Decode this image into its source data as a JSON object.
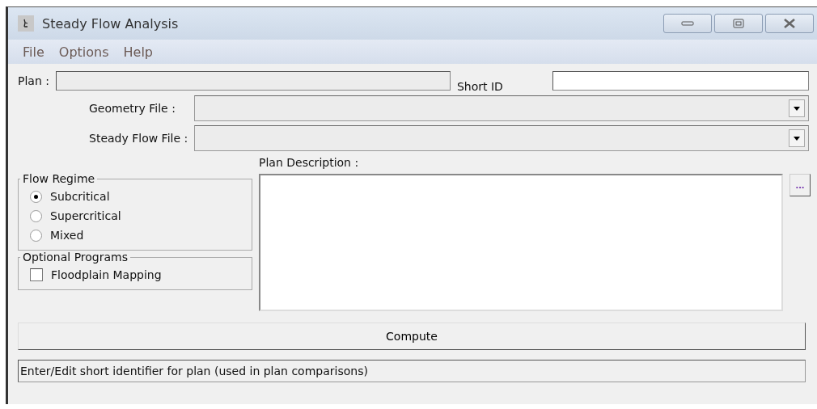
{
  "window": {
    "title": "Steady Flow Analysis"
  },
  "menu": [
    "File",
    "Options",
    "Help"
  ],
  "plan": {
    "label": "Plan :",
    "disabled": true
  },
  "short_id": {
    "label": "Short ID"
  },
  "geometry_file": {
    "label": "Geometry File :"
  },
  "steady_flow_file": {
    "label": "Steady Flow File :"
  },
  "plan_description": {
    "label": "Plan Description :",
    "button": "..."
  },
  "flow_regime": {
    "title": "Flow Regime",
    "options": [
      {
        "label": "Subcritical",
        "selected": true
      },
      {
        "label": "Supercritical",
        "selected": false
      },
      {
        "label": "Mixed",
        "selected": false
      }
    ]
  },
  "optional_programs": {
    "title": "Optional Programs",
    "items": [
      {
        "label": "Floodplain Mapping",
        "checked": false
      }
    ]
  },
  "compute_button": "Compute",
  "status_bar": "Enter/Edit short identifier for plan (used in plan comparisons)"
}
